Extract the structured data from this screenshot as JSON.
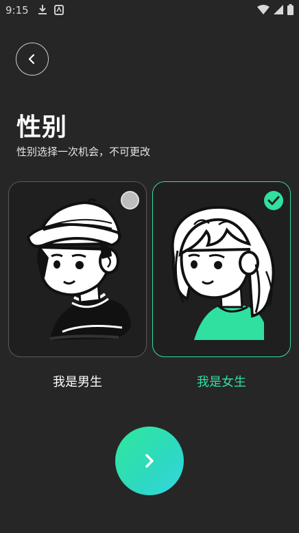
{
  "status_bar": {
    "time": "9:15",
    "icons_left": [
      "download-icon",
      "app-notification-icon"
    ],
    "icons_right": [
      "wifi-icon",
      "signal-icon",
      "battery-icon"
    ]
  },
  "header": {
    "back_icon": "chevron-left-icon",
    "title": "性别",
    "subtitle": "性别选择一次机会，不可更改"
  },
  "options": [
    {
      "id": "male",
      "label": "我是男生",
      "selected": false
    },
    {
      "id": "female",
      "label": "我是女生",
      "selected": true
    }
  ],
  "next_button": {
    "icon": "chevron-right-icon"
  },
  "colors": {
    "background": "#262626",
    "accent": "#2fe0a0",
    "card_border": "#5a5a5a",
    "text": "#ffffff"
  }
}
